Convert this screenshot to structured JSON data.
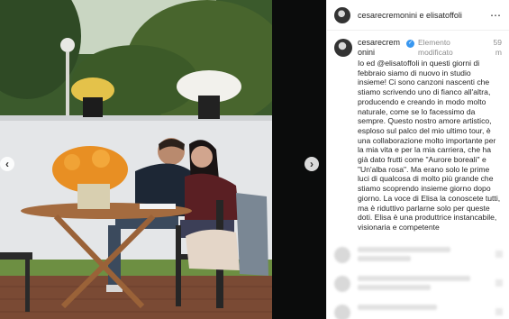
{
  "post": {
    "header_names": "cesarecremonini e elisatoffoli",
    "more_icon": "⋯",
    "caption": {
      "username": "cesarecremonini",
      "edited": "Elemento modificato",
      "time": "59 m",
      "text": "Io ed @elisatoffoli in questi giorni di febbraio siamo di nuovo in studio insieme! Ci sono canzoni nascenti che stiamo scrivendo uno di fianco all'altra, producendo e creando in modo molto naturale, come se lo facessimo da sempre. Questo nostro amore artistico, esploso sul palco del mio ultimo tour, è una collaborazione molto importante per la mia vita e per la mia carriera, che ha già dato frutti come \"Aurore boreali\" e \"Un'alba rosa\". Ma erano solo le prime luci di qualcosa di molto più grande che stiamo scoprendo insieme giorno dopo giorno. La voce di Elisa la conoscete tutti, ma è riduttivo parlarne solo per queste doti. Elisa è una produttrice instancabile, visionaria e competente"
    }
  },
  "media": {
    "prev_glyph": "‹",
    "next_glyph": "›"
  },
  "colors": {
    "verified": "#3897f0",
    "text": "#262626",
    "muted": "#8e8e8e"
  }
}
